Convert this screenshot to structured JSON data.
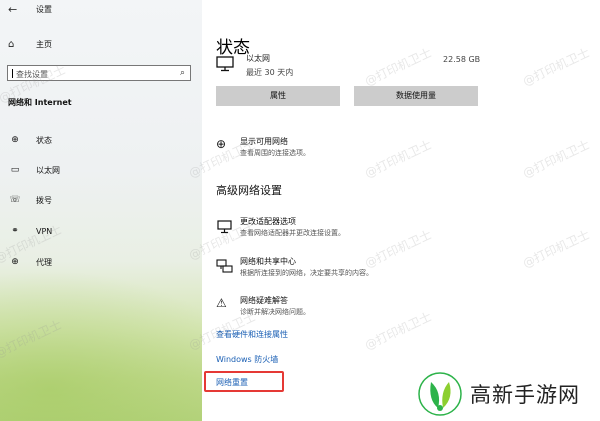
{
  "window": {
    "title": "设置"
  },
  "sidebar": {
    "home_label": "主页",
    "search_placeholder": "查找设置",
    "section_header": "网络和 Internet",
    "items": [
      {
        "label": "状态",
        "icon": "status-globe-icon"
      },
      {
        "label": "以太网",
        "icon": "monitor-icon"
      },
      {
        "label": "拨号",
        "icon": "phone-icon"
      },
      {
        "label": "VPN",
        "icon": "vpn-icon"
      },
      {
        "label": "代理",
        "icon": "globe-icon"
      }
    ]
  },
  "main": {
    "title": "状态",
    "ethernet": {
      "name": "以太网",
      "subtitle": "最近 30 天内",
      "size": "22.58 GB"
    },
    "buttons": {
      "properties": "属性",
      "data_usage": "数据使用量"
    },
    "show_networks": {
      "title": "显示可用网络",
      "desc": "查看周围的连接选项。"
    },
    "advanced_heading": "高级网络设置",
    "options": [
      {
        "title": "更改适配器选项",
        "desc": "查看网络适配器并更改连接设置。",
        "icon": "adapter-icon"
      },
      {
        "title": "网络和共享中心",
        "desc": "根据所连接到的网络，决定要共享的内容。",
        "icon": "sharing-icon"
      },
      {
        "title": "网络疑难解答",
        "desc": "诊断并解决网络问题。",
        "icon": "warning-icon"
      }
    ],
    "links": {
      "hardware": "查看硬件和连接属性",
      "firewall": "Windows 防火墙",
      "reset": "网络重置"
    }
  },
  "watermark": "@打印机卫士",
  "brand": {
    "text": "高新手游网",
    "color": "#2db34a"
  },
  "colors": {
    "link": "#1a5fb4",
    "highlight": "#e53935"
  }
}
